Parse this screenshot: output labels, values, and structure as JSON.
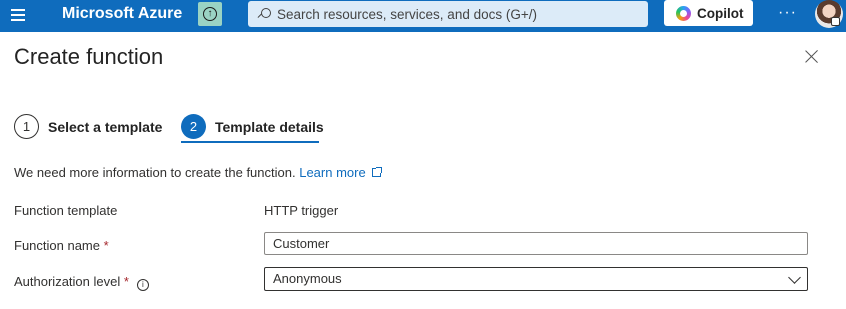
{
  "topbar": {
    "brand": "Microsoft Azure",
    "search_placeholder": "Search resources, services, and docs (G+/)",
    "copilot_label": "Copilot",
    "more_label": "···",
    "color": "#0f6cbd"
  },
  "panel": {
    "title": "Create function",
    "steps": [
      {
        "number": "1",
        "label": "Select a template"
      },
      {
        "number": "2",
        "label": "Template details"
      }
    ],
    "info_text": "We need more information to create the function.",
    "learn_more": "Learn more",
    "fields": {
      "template_label": "Function template",
      "template_value": "HTTP trigger",
      "name_label": "Function name",
      "name_value": "Customer",
      "auth_label": "Authorization level",
      "auth_value": "Anonymous",
      "required_mark": "*"
    }
  }
}
